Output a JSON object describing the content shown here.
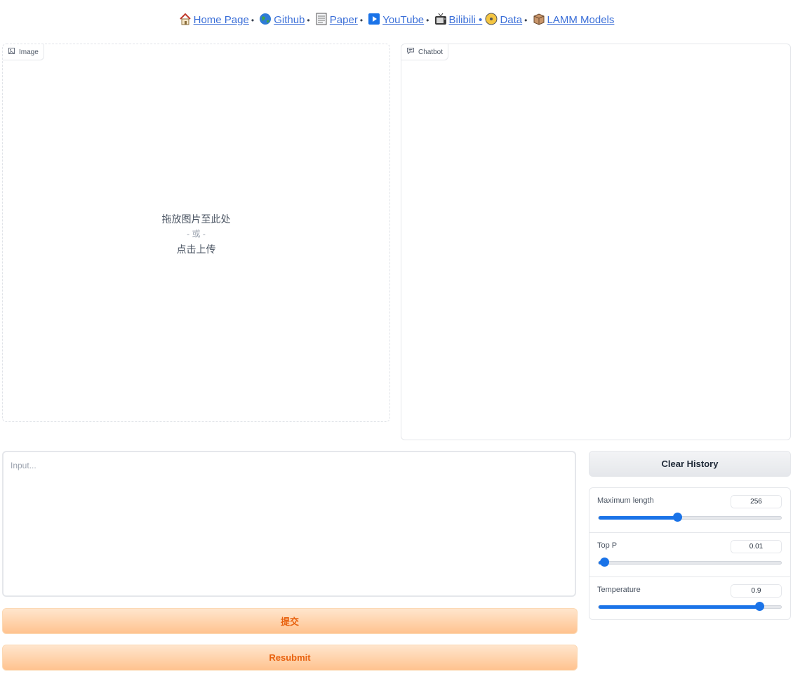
{
  "nav": {
    "links": [
      {
        "label": "Home Page",
        "icon": "house-icon"
      },
      {
        "label": "Github",
        "icon": "globe-icon"
      },
      {
        "label": "Paper",
        "icon": "document-icon"
      },
      {
        "label": "YouTube",
        "icon": "play-icon"
      },
      {
        "label": "Bilibili",
        "icon": "tv-icon"
      },
      {
        "label": "Data",
        "icon": "disc-icon"
      },
      {
        "label": "LAMM Models",
        "icon": "box-icon"
      }
    ],
    "separator": "•"
  },
  "image_panel": {
    "label": "Image",
    "drop_text": "拖放图片至此处",
    "or_text": "- 或 -",
    "click_text": "点击上传"
  },
  "chatbot_panel": {
    "label": "Chatbot"
  },
  "input": {
    "placeholder": "Input..."
  },
  "buttons": {
    "submit": "提交",
    "resubmit": "Resubmit",
    "clear_history": "Clear History"
  },
  "sliders": [
    {
      "label": "Maximum length",
      "value": "256",
      "fraction": 0.43
    },
    {
      "label": "Top P",
      "value": "0.01",
      "fraction": 0.03
    },
    {
      "label": "Temperature",
      "value": "0.9",
      "fraction": 0.88
    }
  ],
  "colors": {
    "accent": "#1a73e8",
    "primary_button": "#ffc38f",
    "primary_text": "#e8620f",
    "link": "#3b6fd8"
  }
}
